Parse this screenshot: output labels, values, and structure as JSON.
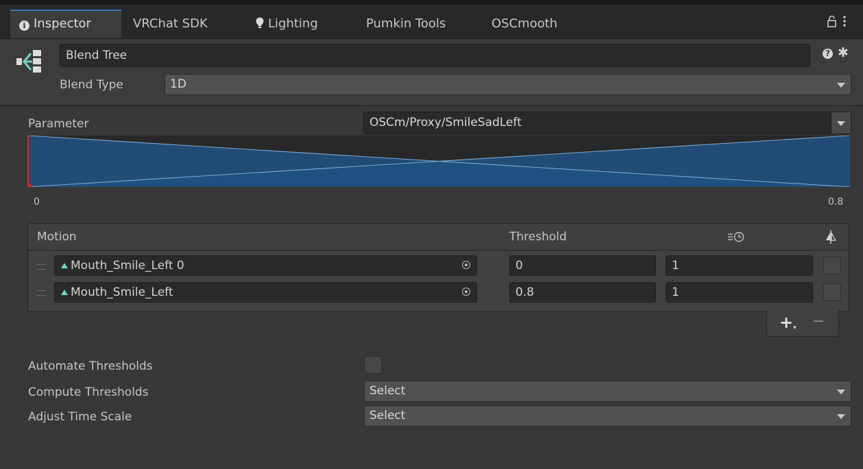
{
  "tabs": [
    {
      "label": "Inspector",
      "active": true,
      "icon": "info-icon"
    },
    {
      "label": "VRChat SDK"
    },
    {
      "label": "Lighting",
      "icon": "bulb-icon"
    },
    {
      "label": "Pumkin Tools"
    },
    {
      "label": "OSCmooth"
    }
  ],
  "window_controls": {
    "lock": "lock-icon",
    "menu": "kebab-menu-icon"
  },
  "header": {
    "object_name": "Blend Tree",
    "icon": "blend-tree-icon",
    "blend_type_label": "Blend Type",
    "blend_type_value": "1D"
  },
  "parameter": {
    "label": "Parameter",
    "value": "OSCm/Proxy/SmileSadLeft"
  },
  "graph": {
    "min_label": "0",
    "max_label": "0.8",
    "current_value": 0,
    "fill_color": "#1f5283",
    "line_color": "#7eaad3",
    "marker_color": "#e02222"
  },
  "motion_list": {
    "headers": {
      "motion": "Motion",
      "threshold": "Threshold",
      "time_scale_icon": "time-scale-icon",
      "mirror_icon": "mirror-icon"
    },
    "rows": [
      {
        "motion": "Mouth_Smile_Left 0",
        "threshold": "0",
        "time_scale": "1",
        "mirror": false
      },
      {
        "motion": "Mouth_Smile_Left",
        "threshold": "0.8",
        "time_scale": "1",
        "mirror": false
      }
    ],
    "add_label": "+",
    "remove_label": "−"
  },
  "settings": {
    "automate_label": "Automate Thresholds",
    "automate_checked": false,
    "compute_label": "Compute Thresholds",
    "compute_value": "Select",
    "adjust_label": "Adjust Time Scale",
    "adjust_value": "Select"
  },
  "colors": {
    "accent_tab": "#3a79bb",
    "motion_icon": "#6fd4c4"
  }
}
